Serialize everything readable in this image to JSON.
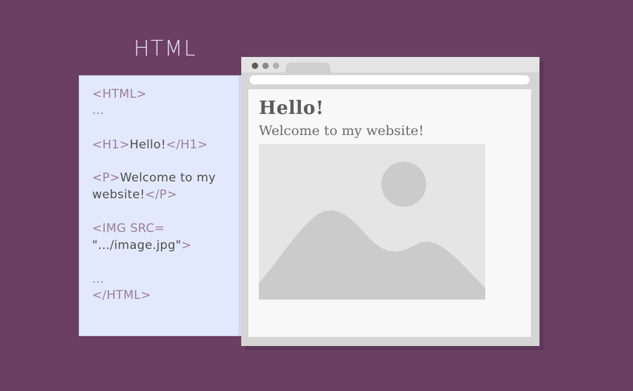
{
  "heading": "HTML",
  "code": {
    "line1_tag": "<HTML>",
    "line2_dots": "...",
    "line3_open": "<H1>",
    "line3_text": "Hello!",
    "line3_close": "</H1>",
    "line4_open": "<P>",
    "line4_text": "Welcome to my",
    "line5_text": "website!",
    "line5_close": "</P>",
    "line6_tag": "<IMG SRC=",
    "line7_text": "\".../image.jpg\"",
    "line7_close": ">",
    "line8_dots": "...",
    "line9_tag": "</HTML>"
  },
  "browser": {
    "page_heading": "Hello!",
    "page_paragraph": "Welcome to my website!",
    "image_icon": "image-placeholder-icon",
    "dot_colors": [
      "#5b5b5b",
      "#8a8a8a",
      "#b0b0b0"
    ]
  },
  "colors": {
    "background": "#6a3f63",
    "code_panel": "#e3e9fd",
    "tag_text": "#9a7f96"
  }
}
